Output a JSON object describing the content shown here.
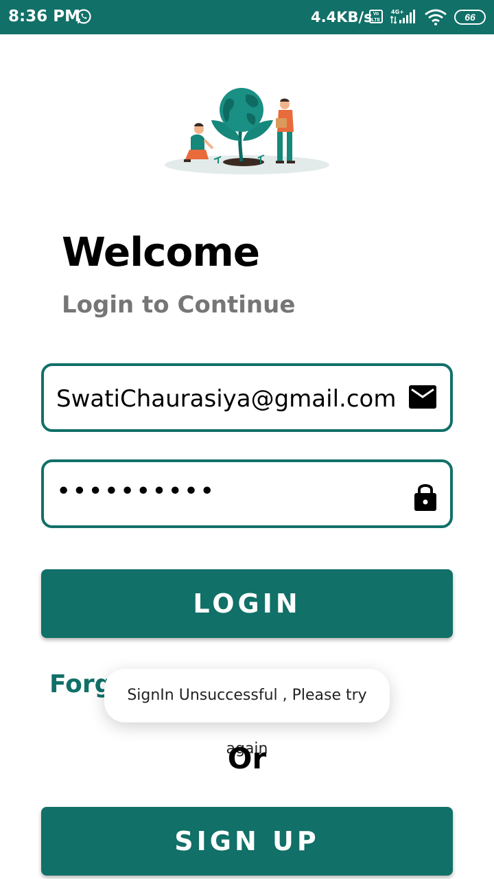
{
  "status_bar": {
    "time": "8:36 PM",
    "network_speed": "4.4KB/s",
    "volte": "Vo LTE",
    "network_type": "4G+",
    "battery": "66",
    "icons": [
      "whatsapp-icon",
      "volte-icon",
      "signal-icon",
      "wifi-icon",
      "battery-icon"
    ]
  },
  "header": {
    "title": "Welcome",
    "subtitle": "Login to Continue"
  },
  "form": {
    "email_value": "SwatiChaurasiya@gmail.com",
    "email_icon": "mail-icon",
    "password_value": "••••••••••",
    "password_icon": "lock-icon",
    "login_label": "LOGIN",
    "forgot_label": "Forgot Password",
    "or_label": "Or",
    "signup_label": "SIGN UP"
  },
  "toast": {
    "message": "SignIn Unsuccessful , Please try again"
  },
  "colors": {
    "primary": "#117068",
    "subtitle": "#767676",
    "background": "#ffffff"
  }
}
